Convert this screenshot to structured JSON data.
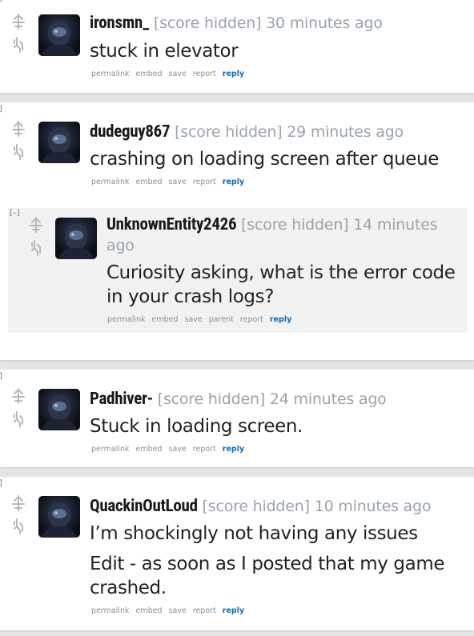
{
  "collapse_label": "[–]",
  "comments": [
    {
      "author": "ironsmn_",
      "score": "[score hidden]",
      "time": "30 minutes ago",
      "body": [
        "stuck in elevator"
      ],
      "actions": [
        "permalink",
        "embed",
        "save",
        "report",
        "reply"
      ]
    },
    {
      "author": "dudeguy867",
      "score": "[score hidden]",
      "time": "29 minutes ago",
      "body": [
        "crashing on loading screen after queue"
      ],
      "actions": [
        "permalink",
        "embed",
        "save",
        "report",
        "reply"
      ],
      "reply": {
        "author": "UnknownEntity2426",
        "score": "[score hidden]",
        "time": "14 minutes ago",
        "body": [
          "Curiosity asking, what is the error code in your crash logs?"
        ],
        "actions": [
          "permalink",
          "embed",
          "save",
          "parent",
          "report",
          "reply"
        ]
      }
    },
    {
      "author": "Padhiver-",
      "score": "[score hidden]",
      "time": "24 minutes ago",
      "body": [
        "Stuck in loading screen."
      ],
      "actions": [
        "permalink",
        "embed",
        "save",
        "report",
        "reply"
      ]
    },
    {
      "author": "QuackinOutLoud",
      "score": "[score hidden]",
      "time": "10 minutes ago",
      "body": [
        "I’m shockingly not having any issues",
        "Edit - as soon as I posted that my game crashed."
      ],
      "actions": [
        "permalink",
        "embed",
        "save",
        "report",
        "reply"
      ]
    }
  ]
}
